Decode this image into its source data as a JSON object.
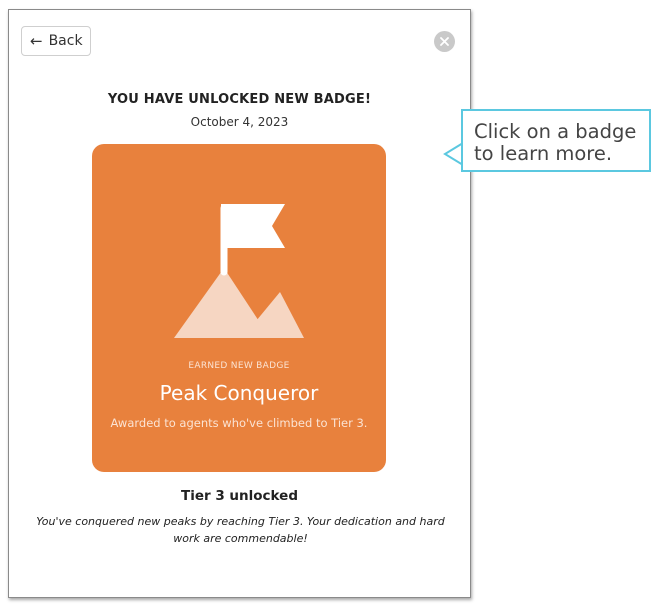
{
  "modal": {
    "back_label": "Back",
    "back_icon": "arrow-left-icon",
    "close_icon": "close-icon",
    "headline": "YOU HAVE UNLOCKED NEW BADGE!",
    "date": "October 4, 2023"
  },
  "badge": {
    "icon": "mountain-flag-icon",
    "kicker": "EARNED NEW BADGE",
    "name": "Peak Conqueror",
    "description": "Awarded to agents who've climbed to Tier 3.",
    "color": "#e8813d"
  },
  "tier": {
    "title": "Tier 3 unlocked",
    "message": "You've conquered new peaks by reaching Tier 3. Your dedication and hard work are commendable!"
  },
  "callout": {
    "text": "Click on a badge to learn more.",
    "border_color": "#5bc8e0"
  }
}
